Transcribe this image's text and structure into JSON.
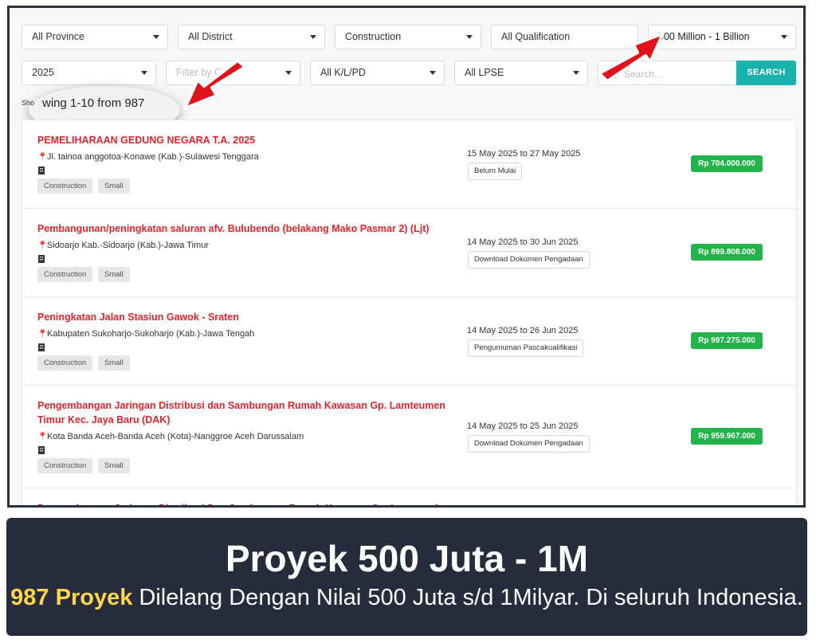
{
  "filters": {
    "province": "All Province",
    "district": "All District",
    "category": "Construction",
    "qualification": "All Qualification",
    "value_range": "500 Million - 1 Billion",
    "year": "2025",
    "city_placeholder": "Filter by City",
    "klpd": "All K/L/PD",
    "lpse": "All LPSE",
    "search_placeholder": "Search...",
    "search_button": "SEARCH"
  },
  "results": {
    "showing_prefix": "Sho",
    "showing_text": "wing 1-10 from 987"
  },
  "tenders": [
    {
      "title": "PEMELIHARAAN GEDUNG NEGARA T.A. 2025",
      "location": "Jl. tainoa anggotoa-Konawe (Kab.)-Sulawesi Tenggara",
      "tags": [
        "Construction",
        "Small"
      ],
      "date_range": "15 May 2025 to 27 May 2025",
      "status": "Belum Mulai",
      "price": "Rp 704.000.000"
    },
    {
      "title": "Pembangunan/peningkatan saluran afv. Bulubendo (belakang Mako Pasmar 2) (Ljt)",
      "location": "Sidoarjo Kab.-Sidoarjo (Kab.)-Jawa Timur",
      "tags": [
        "Construction",
        "Small"
      ],
      "date_range": "14 May 2025 to 30 Jun 2025",
      "status": "Download Dokumen Pengadaan",
      "price": "Rp 899.808.000"
    },
    {
      "title": "Peningkatan Jalan Stasiun Gawok - Sraten",
      "location": "Kabupaten Sukoharjo-Sukoharjo (Kab.)-Jawa Tengah",
      "tags": [
        "Construction",
        "Small"
      ],
      "date_range": "14 May 2025 to 26 Jun 2025",
      "status": "Pengumuman Pascakualifikasi",
      "price": "Rp 997.275.000"
    },
    {
      "title": "Pengembangan Jaringan Distribusi dan Sambungan Rumah Kawasan Gp. Lamteumen Timur Kec. Jaya Baru (DAK)",
      "location": "Kota Banda Aceh-Banda Aceh (Kota)-Nanggroe Aceh Darussalam",
      "tags": [
        "Construction",
        "Small"
      ],
      "date_range": "14 May 2025 to 25 Jun 2025",
      "status": "Download Dokumen Pengadaan",
      "price": "Rp 959.967.000"
    },
    {
      "title": "Pengembangan Jaringan Distribusi Dan Sambungan Rumah Kawasan Gp. Lamgugob"
    }
  ],
  "banner": {
    "title": "Proyek 500 Juta - 1M",
    "highlight": "987 Proyek",
    "subtitle": " Dilelang Dengan Nilai 500 Juta s/d 1Milyar. Di seluruh Indonesia."
  },
  "colors": {
    "title_red": "#e0242b",
    "price_green": "#22b34a",
    "search_teal": "#17b3ac",
    "banner_bg": "#262c3b",
    "highlight_yellow": "#ffd54a",
    "arrow_red": "#e0121a"
  },
  "icons": [
    "location-pin-icon",
    "building-icon",
    "search-icon",
    "caret-down-icon",
    "pointer-arrow"
  ]
}
